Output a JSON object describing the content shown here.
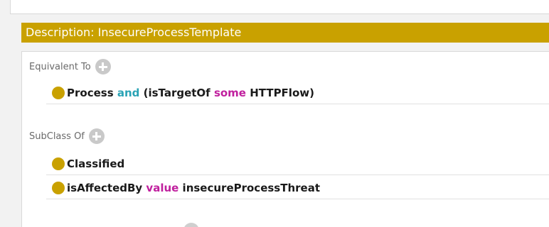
{
  "header": {
    "title": "Description: InsecureProcessTemplate"
  },
  "equivalent_to": {
    "label": "Equivalent To",
    "axioms": [
      {
        "parts": [
          "Process",
          " and ",
          "(isTargetOf ",
          "some",
          " HTTPFlow)"
        ]
      }
    ]
  },
  "subclass_of": {
    "label": "SubClass Of",
    "axioms": [
      {
        "text": "Classified"
      },
      {
        "parts": [
          "isAffectedBy ",
          "value",
          " insecureProcessThreat"
        ]
      }
    ]
  },
  "colors": {
    "header_bg": "#c9a100",
    "class_dot": "#c9a100",
    "keyword_and": "#2aa3b5",
    "keyword_some_value": "#c0209e"
  },
  "icons": [
    "add-icon",
    "class-dot-icon"
  ]
}
